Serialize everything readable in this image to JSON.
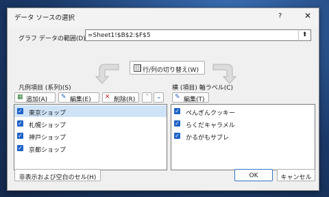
{
  "window": {
    "title": "データ ソースの選択",
    "help": "?",
    "close": "✕"
  },
  "range": {
    "label": "グラフ データの範囲(D):",
    "value": "=Sheet1!$B$2:$F$5",
    "collapse": "⬆"
  },
  "switch_button": {
    "label": "行/列の切り替え(W)"
  },
  "legend": {
    "label": "凡例項目 (系列)(S)",
    "buttons": {
      "add": "追加(A)",
      "edit": "編集(E)",
      "delete": "削除(R)",
      "up": "⌃",
      "down": "⌄"
    },
    "items": [
      {
        "label": "東京ショップ",
        "checked": true,
        "selected": true
      },
      {
        "label": "札幌ショップ",
        "checked": true,
        "selected": false
      },
      {
        "label": "神戸ショップ",
        "checked": true,
        "selected": false
      },
      {
        "label": "京都ショップ",
        "checked": true,
        "selected": false
      }
    ]
  },
  "axis": {
    "label": "横 (項目) 軸ラベル(C)",
    "buttons": {
      "edit": "編集(T)"
    },
    "items": [
      {
        "label": "ぺんぎんクッキー",
        "checked": true
      },
      {
        "label": "らくだキャラメル",
        "checked": true
      },
      {
        "label": "かるがもサブレ",
        "checked": true
      }
    ]
  },
  "footer": {
    "hidden_empty": "非表示および空白のセル(H)",
    "ok": "OK",
    "cancel": "キャンセル"
  },
  "colors": {
    "accent": "#1f63c7",
    "selection": "#cfe3f6"
  },
  "icons": {
    "check": "✓",
    "delete": "✕"
  }
}
